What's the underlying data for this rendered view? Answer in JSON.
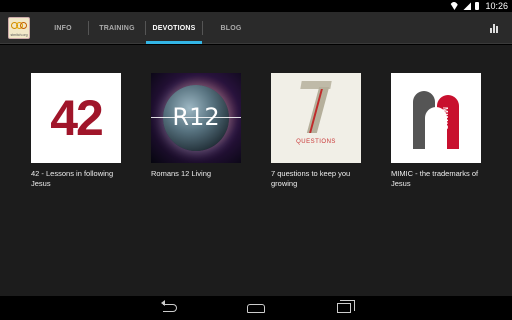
{
  "status_bar": {
    "time": "10:26"
  },
  "app": {
    "logo_text": "stmitch.org"
  },
  "tabs": [
    {
      "label": "INFO",
      "active": false
    },
    {
      "label": "TRAINING",
      "active": false
    },
    {
      "label": "DEVOTIONS",
      "active": true
    },
    {
      "label": "BLOG",
      "active": false
    }
  ],
  "colors": {
    "accent": "#33b5e5",
    "action_bar": "#2a2a2a",
    "content_bg": "#1c1c1c"
  },
  "devotions": [
    {
      "title": "42 - Lessons in following Jesus",
      "cover_text": "42"
    },
    {
      "title": "Romans 12 Living",
      "cover_text": "R12"
    },
    {
      "title": "7 questions to keep you growing",
      "cover_text": "QUESTIONS"
    },
    {
      "title": "MIMIC - the trademarks of Jesus",
      "cover_text": "MIMIC"
    }
  ]
}
